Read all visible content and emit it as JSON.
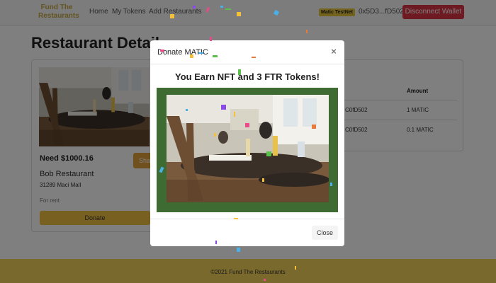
{
  "navbar": {
    "brand": "Fund The Restaurants",
    "links": [
      "Home",
      "My Tokens",
      "Add Restaurants"
    ],
    "network_badge": "Matic TestNet",
    "wallet_address": "0x5D3...fD502",
    "disconnect_label": "Disconnect Wallet"
  },
  "page": {
    "title": "Restaurant Detail",
    "card": {
      "need": "Need $1000.16",
      "share_label": "Sha",
      "name": "Bob Restaurant",
      "address": "31289 Maci Mall",
      "status": "For rent",
      "donate_label": "Donate"
    },
    "donations": {
      "amount_header": "Amount",
      "rows": [
        {
          "address": "C0fD502",
          "amount": "1 MATIC"
        },
        {
          "address": "C0fD502",
          "amount": "0.1 MATIC"
        }
      ]
    }
  },
  "modal": {
    "title": "Donate MATIC",
    "close_symbol": "×",
    "reward_text": "You Earn NFT and 3 FTR Tokens!",
    "close_label": "Close"
  },
  "footer": {
    "text": "©2021 Fund The Restaurants"
  },
  "colors": {
    "brand": "#c8a840",
    "danger": "#dc3545",
    "warning": "#f0c040",
    "footer": "#f2d35a",
    "nft_frame": "#3e6b31"
  },
  "icons": {
    "modal_close": "close-icon"
  }
}
